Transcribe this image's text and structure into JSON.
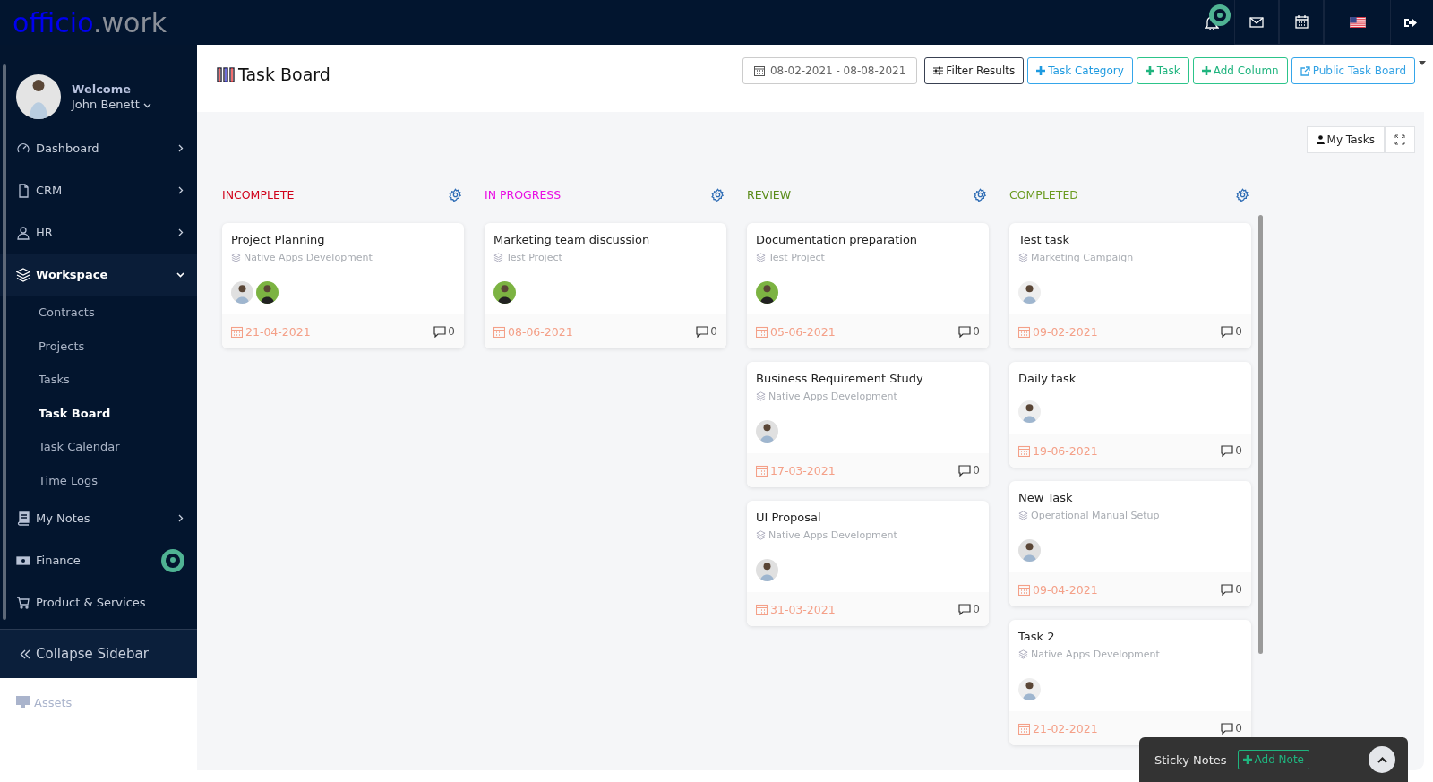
{
  "logo": {
    "part_1": "officio",
    "part_2": ".work"
  },
  "topbar": {
    "notification_marker": true
  },
  "sidebar": {
    "user": {
      "greeting": "Welcome",
      "name": "John Benett"
    },
    "items": [
      {
        "label": "Dashboard",
        "kind": "group",
        "expanded": false,
        "marker": false
      },
      {
        "label": "CRM",
        "kind": "group",
        "expanded": false,
        "marker": false
      },
      {
        "label": "HR",
        "kind": "group",
        "expanded": false,
        "marker": false
      },
      {
        "label": "Workspace",
        "kind": "group",
        "expanded": true,
        "marker": false,
        "children": [
          {
            "label": "Contracts",
            "selected": false
          },
          {
            "label": "Projects",
            "selected": false
          },
          {
            "label": "Tasks",
            "selected": false
          },
          {
            "label": "Task Board",
            "selected": true
          },
          {
            "label": "Task Calendar",
            "selected": false
          },
          {
            "label": "Time Logs",
            "selected": false
          }
        ]
      },
      {
        "label": "My Notes",
        "kind": "group",
        "expanded": false,
        "marker": false
      },
      {
        "label": "Finance",
        "kind": "group",
        "expanded": false,
        "marker": true
      },
      {
        "label": "Product & Services",
        "kind": "link",
        "expanded": false,
        "marker": false
      }
    ],
    "collapse": "Collapse Sidebar",
    "below": [
      {
        "label": "Assets"
      }
    ]
  },
  "page": {
    "title": "Task Board",
    "date_range": "08-02-2021 - 08-08-2021",
    "buttons": [
      {
        "label": "Filter Results",
        "kind": "filter"
      },
      {
        "label": "Task Category",
        "kind": "add-blue"
      },
      {
        "label": "Task",
        "kind": "add-green"
      },
      {
        "label": "Add Column",
        "kind": "add-green"
      },
      {
        "label": "Public Task Board",
        "kind": "link"
      }
    ],
    "my_tasks": "My Tasks"
  },
  "columns": [
    {
      "title": "INCOMPLETE",
      "color": "#d0021b",
      "cards": [
        {
          "title": "Project Planning",
          "project": "Native Apps Development",
          "avatars": [
            {
              "color": "#e0e0e0"
            },
            {
              "color": "#7cb342"
            }
          ],
          "date": "21-04-2021",
          "comments": "0"
        }
      ]
    },
    {
      "title": "IN PROGRESS",
      "color": "#e90ce4",
      "cards": [
        {
          "title": "Marketing team discussion",
          "project": "Test Project",
          "avatars": [
            {
              "color": "#7cb342"
            }
          ],
          "date": "08-06-2021",
          "comments": "0"
        }
      ]
    },
    {
      "title": "REVIEW",
      "color": "#5b8c1a",
      "cards": [
        {
          "title": "Documentation preparation",
          "project": "Test Project",
          "avatars": [
            {
              "color": "#7cb342"
            }
          ],
          "date": "05-06-2021",
          "comments": "0"
        },
        {
          "title": "Business Requirement Study",
          "project": "Native Apps Development",
          "avatars": [
            {
              "color": "#e0e0e0"
            }
          ],
          "date": "17-03-2021",
          "comments": "0"
        },
        {
          "title": "UI Proposal",
          "project": "Native Apps Development",
          "avatars": [
            {
              "color": "#e0e0e0"
            }
          ],
          "date": "31-03-2021",
          "comments": "0"
        }
      ]
    },
    {
      "title": "COMPLETED",
      "color": "#6a9a1f",
      "cards": [
        {
          "title": "Test task",
          "project": "Marketing Campaign",
          "avatars": [
            {
              "color": "#eeeeee"
            }
          ],
          "date": "09-02-2021",
          "comments": "0"
        },
        {
          "title": "Daily task",
          "avatars": [
            {
              "color": "#eeeeee"
            }
          ],
          "date": "19-06-2021",
          "comments": "0"
        },
        {
          "title": "New Task",
          "project": "Operational Manual Setup",
          "avatars": [
            {
              "color": "#e0e0e0"
            }
          ],
          "date": "09-04-2021",
          "comments": "0"
        },
        {
          "title": "Task 2",
          "project": "Native Apps Development",
          "avatars": [
            {
              "color": "#eeeeee"
            }
          ],
          "date": "21-02-2021",
          "comments": "0"
        }
      ]
    }
  ],
  "sticky_notes": {
    "title": "Sticky Notes",
    "add": "Add Note"
  }
}
